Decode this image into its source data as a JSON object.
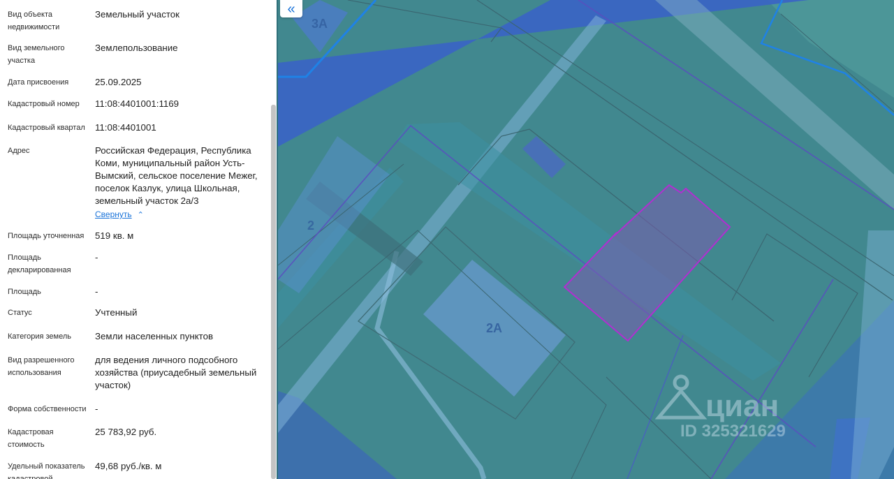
{
  "panel": {
    "fields": [
      {
        "label": "Вид объекта недвижимости",
        "value": "Земельный участок"
      },
      {
        "label": "Вид земельного участка",
        "value": "Землепользование"
      },
      {
        "label": "Дата присвоения",
        "value": "25.09.2025"
      },
      {
        "label": "Кадастровый номер",
        "value": "11:08:4401001:1169"
      },
      {
        "label": "Кадастровый квартал",
        "value": "11:08:4401001"
      },
      {
        "label": "Адрес",
        "value": "Российская Федерация, Республика Коми, муниципальный район Усть-Вымский, сельское поселение Межег, поселок Казлук, улица Школьная, земельный участок 2а/3"
      },
      {
        "label": "Площадь уточненная",
        "value": "519 кв. м"
      },
      {
        "label": "Площадь декларированная",
        "value": "-"
      },
      {
        "label": "Площадь",
        "value": "-"
      },
      {
        "label": "Статус",
        "value": "Учтенный"
      },
      {
        "label": "Категория земель",
        "value": "Земли населенных пунктов"
      },
      {
        "label": "Вид разрешенного использования",
        "value": "для ведения личного подсобного хозяйства (приусадебный земельный участок)"
      },
      {
        "label": "Форма собственности",
        "value": "-"
      },
      {
        "label": "Кадастровая стоимость",
        "value": "25 783,92 руб."
      },
      {
        "label": "Удельный показатель кадастровой",
        "value": "49,68 руб./кв. м"
      }
    ],
    "collapse_label": "Свернуть",
    "collapse_icon": "chevron-up-icon"
  },
  "map": {
    "labels": {
      "plot_3a": "3А",
      "plot_2": "2",
      "plot_2a": "2А"
    },
    "watermark": {
      "brand": "циан",
      "id": "ID 325321629"
    },
    "highlight_color": "#b12fd1",
    "zone_color": "#3a64c4",
    "base_color": "#41888f"
  },
  "collapse_button": {
    "icon": "double-chevron-left-icon",
    "glyph": "«"
  }
}
